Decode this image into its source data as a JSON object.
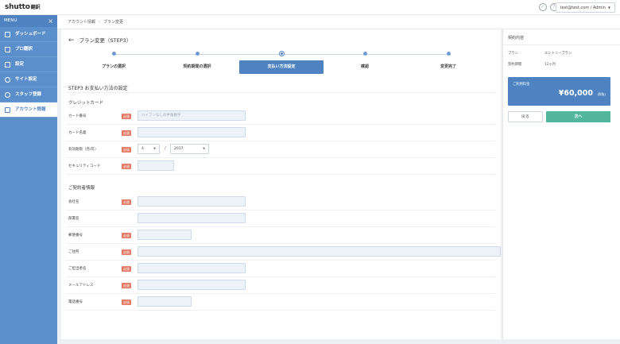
{
  "header": {
    "logo_main": "shutto",
    "logo_suffix": "翻訳",
    "user_label": "test@test.com / Admin"
  },
  "sidebar": {
    "title": "MENU",
    "items": [
      {
        "label": "ダッシュボード"
      },
      {
        "label": "プロ翻訳"
      },
      {
        "label": "設定"
      },
      {
        "label": "サイト設定"
      },
      {
        "label": "スタッフ登録"
      },
      {
        "label": "アカウント情報"
      }
    ]
  },
  "breadcrumb": {
    "items": [
      "アカウント情報",
      "プラン変更"
    ]
  },
  "page": {
    "title": "プラン変更（STEP3）"
  },
  "steps": [
    {
      "label": "プランの選択"
    },
    {
      "label": "契約期間の選択"
    },
    {
      "label": "支払い方法設定"
    },
    {
      "label": "確認"
    },
    {
      "label": "変更完了"
    }
  ],
  "form": {
    "heading": "STEP3 お支払い方法の設定",
    "required_badge": "必須",
    "card_section": "クレジットカード",
    "card_number_label": "カード番号",
    "card_number_placeholder": "ハイフンなしの半角数字",
    "card_name_label": "カード名義",
    "expiry_label": "有効期限（月/年）",
    "expiry_month": "4",
    "expiry_sep": "/",
    "expiry_year": "2017",
    "security_label": "セキュリティコード",
    "contract_section": "ご契約者情報",
    "company_label": "会社名",
    "dept_label": "部署名",
    "zip_label": "郵便番号",
    "address_label": "ご住所",
    "person_label": "ご担当者名",
    "email_label": "メールアドレス",
    "phone_label": "電話番号"
  },
  "summary": {
    "heading": "契約内容",
    "plan_label": "プラン",
    "plan_value": "エントリープラン",
    "period_label": "契約期間",
    "period_value": "12ヶ月",
    "price_label": "ご利用料金",
    "price_value": "¥60,000",
    "price_tax": "(税抜)",
    "back_button": "戻る",
    "next_button": "次へ"
  }
}
